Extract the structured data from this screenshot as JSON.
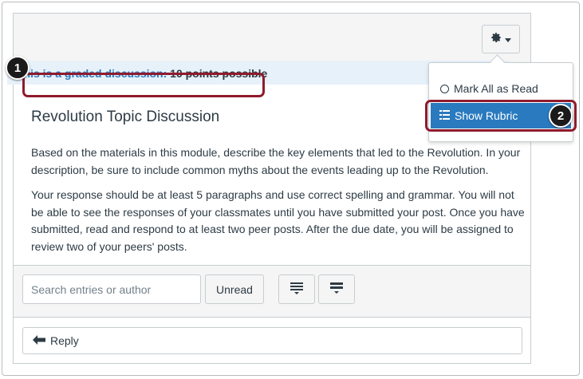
{
  "graded": {
    "prefix": "This is a graded discussion:",
    "points": "10 points possible"
  },
  "topic": {
    "title": "Revolution Topic Discussion",
    "paragraphs": [
      "Based on the materials in this module, describe the key elements that led to the Revolution. In your description, be sure to include common myths about the events leading up to the Revolution.",
      "Your response should be at least 5 paragraphs and use correct spelling and grammar. You will not be able to see the responses of your classmates until you have submitted your post. Once you have submitted, read and respond to at least two peer posts. After the due date, you will be assigned to review two of your peers' posts."
    ]
  },
  "toolbar": {
    "search_placeholder": "Search entries or author",
    "unread_label": "Unread"
  },
  "reply": {
    "label": "Reply"
  },
  "settings_menu": {
    "items": [
      {
        "label": "Mark All as Read",
        "icon": "radio-circle-icon"
      },
      {
        "label": "Show Rubric",
        "icon": "list-icon",
        "highlighted": true
      }
    ]
  },
  "callouts": {
    "one": "1",
    "two": "2"
  },
  "colors": {
    "accent": "#2a7abf",
    "highlight_border": "#8f1b2c",
    "text": "#2d3b45"
  }
}
